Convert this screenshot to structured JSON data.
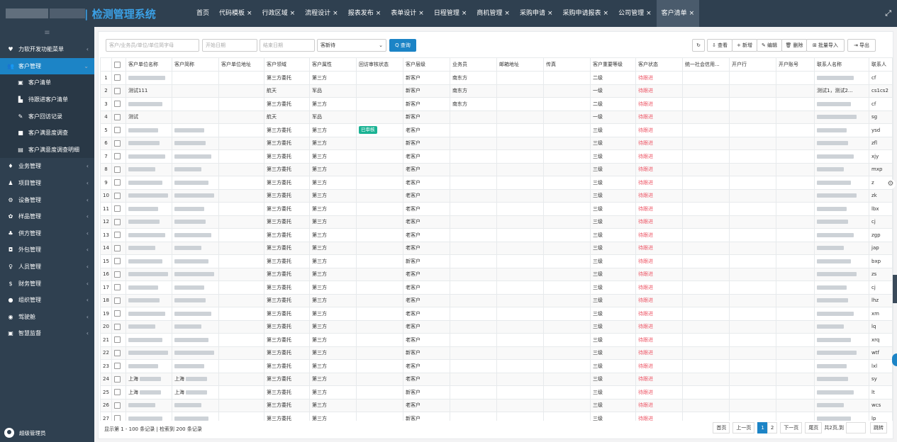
{
  "app": {
    "title": "| 检测管理系统"
  },
  "tabs": [
    {
      "label": "首页",
      "closable": false
    },
    {
      "label": "代码模板",
      "closable": true
    },
    {
      "label": "行政区域",
      "closable": true
    },
    {
      "label": "流程设计",
      "closable": true
    },
    {
      "label": "报表发布",
      "closable": true
    },
    {
      "label": "表单设计",
      "closable": true
    },
    {
      "label": "日程管理",
      "closable": true
    },
    {
      "label": "商机管理",
      "closable": true
    },
    {
      "label": "采购申请",
      "closable": true
    },
    {
      "label": "采购申请报表",
      "closable": true
    },
    {
      "label": "公司管理",
      "closable": true
    },
    {
      "label": "客户清单",
      "closable": true,
      "active": true
    }
  ],
  "sidebar": {
    "toggle_icon": "≡",
    "items": [
      {
        "icon": "♥",
        "label": "力软开发功能菜单",
        "arrow": "‹"
      },
      {
        "icon": "👥",
        "label": "客户管理",
        "arrow": "⌄",
        "active": true
      },
      {
        "icon": "▣",
        "label": "客户清单",
        "sub": true
      },
      {
        "icon": "▙",
        "label": "待跟进客户清单",
        "sub": true
      },
      {
        "icon": "✎",
        "label": "客户回访记录",
        "sub": true
      },
      {
        "icon": "■",
        "label": "客户满意度调查",
        "sub": true
      },
      {
        "icon": "▤",
        "label": "客户满意度调查明细",
        "sub": true
      },
      {
        "icon": "♦",
        "label": "业务管理",
        "arrow": "‹"
      },
      {
        "icon": "♟",
        "label": "项目管理",
        "arrow": "‹"
      },
      {
        "icon": "⚙",
        "label": "设备管理",
        "arrow": "‹"
      },
      {
        "icon": "✿",
        "label": "样品管理",
        "arrow": "‹"
      },
      {
        "icon": "♣",
        "label": "供方管理",
        "arrow": "‹"
      },
      {
        "icon": "◘",
        "label": "外包管理",
        "arrow": "‹"
      },
      {
        "icon": "♀",
        "label": "人员管理",
        "arrow": "‹"
      },
      {
        "icon": "$",
        "label": "财务管理",
        "arrow": "‹"
      },
      {
        "icon": "●",
        "label": "组织管理",
        "arrow": "‹"
      },
      {
        "icon": "◉",
        "label": "驾驶舱",
        "arrow": "‹"
      },
      {
        "icon": "▣",
        "label": "智慧监督",
        "arrow": "‹"
      }
    ],
    "user": "超级管理员"
  },
  "toolbar": {
    "search_placeholder": "客户/业务员/单位/单位简字母",
    "start_placeholder": "开始日期",
    "end_placeholder": "结束日期",
    "status_select": "客新待",
    "query_label": "Q 查询",
    "buttons": {
      "refresh": "↻",
      "view": "⇩ 查看",
      "add": "+ 新增",
      "edit": "✎ 编辑",
      "delete": "🗑 删除",
      "import": "⊞ 批量导入",
      "export": "⇥ 导出"
    }
  },
  "table": {
    "headers": [
      "",
      "",
      "客户单位名称",
      "客户简称",
      "客户单位地址",
      "客户领域",
      "客户属性",
      "回访审核状态",
      "客户层级",
      "业务员",
      "邮箱地址",
      "传真",
      "客户重要等级",
      "客户状态",
      "统一社会信用...",
      "开户行",
      "开户账号",
      "联系人名称",
      "联系人"
    ],
    "rows": [
      {
        "n": "1",
        "name": "blur",
        "short": "",
        "field": "第三方委托",
        "attr": "第三方",
        "audit": "",
        "level": "新客户",
        "sales": "南东方",
        "grade": "二级",
        "status": "待跟进",
        "contact": "blur",
        "code": "cf"
      },
      {
        "n": "2",
        "name": "测试111",
        "short": "",
        "field": "航天",
        "attr": "军品",
        "audit": "",
        "level": "新客户",
        "sales": "南东方",
        "grade": "一级",
        "status": "待跟进",
        "contact": "测试1，测试2...",
        "code": "cs1cs2"
      },
      {
        "n": "3",
        "name": "blur",
        "short": "",
        "field": "第三方委托",
        "attr": "第三方",
        "audit": "",
        "level": "新客户",
        "sales": "南东方",
        "grade": "二级",
        "status": "待跟进",
        "contact": "blur",
        "code": "cf"
      },
      {
        "n": "4",
        "name": "测试",
        "short": "",
        "field": "航天",
        "attr": "军品",
        "audit": "",
        "level": "新客户",
        "sales": "",
        "grade": "一级",
        "status": "待跟进",
        "contact": "blur",
        "code": "sg"
      },
      {
        "n": "5",
        "name": "blur",
        "short": "blur",
        "field": "第三方委托",
        "attr": "第三方",
        "audit": "已审核",
        "level": "老客户",
        "sales": "",
        "grade": "三级",
        "status": "待跟进",
        "contact": "blur",
        "code": "ysd"
      },
      {
        "n": "6",
        "name": "blur",
        "short": "blur",
        "field": "第三方委托",
        "attr": "第三方",
        "audit": "",
        "level": "新客户",
        "sales": "",
        "grade": "三级",
        "status": "待跟进",
        "contact": "blur",
        "code": "zfl"
      },
      {
        "n": "7",
        "name": "blur",
        "short": "blur",
        "field": "第三方委托",
        "attr": "第三方",
        "audit": "",
        "level": "老客户",
        "sales": "",
        "grade": "三级",
        "status": "待跟进",
        "contact": "blur",
        "code": "xjy"
      },
      {
        "n": "8",
        "name": "blur",
        "short": "blur",
        "field": "第三方委托",
        "attr": "第三方",
        "audit": "",
        "level": "老客户",
        "sales": "",
        "grade": "三级",
        "status": "待跟进",
        "contact": "blur",
        "code": "mxp"
      },
      {
        "n": "9",
        "name": "blur",
        "short": "blur",
        "field": "第三方委托",
        "attr": "第三方",
        "audit": "",
        "level": "老客户",
        "sales": "",
        "grade": "三级",
        "status": "待跟进",
        "contact": "blur",
        "code": "z"
      },
      {
        "n": "10",
        "name": "blur",
        "short": "blur",
        "field": "第三方委托",
        "attr": "第三方",
        "audit": "",
        "level": "老客户",
        "sales": "",
        "grade": "三级",
        "status": "待跟进",
        "contact": "blur",
        "code": "zk"
      },
      {
        "n": "11",
        "name": "blur",
        "short": "blur",
        "field": "第三方委托",
        "attr": "第三方",
        "audit": "",
        "level": "老客户",
        "sales": "",
        "grade": "三级",
        "status": "待跟进",
        "contact": "blur",
        "code": "lbx"
      },
      {
        "n": "12",
        "name": "blur",
        "short": "blur",
        "field": "第三方委托",
        "attr": "第三方",
        "audit": "",
        "level": "老客户",
        "sales": "",
        "grade": "三级",
        "status": "待跟进",
        "contact": "blur",
        "code": "cj"
      },
      {
        "n": "13",
        "name": "blur",
        "short": "blur",
        "field": "第三方委托",
        "attr": "第三方",
        "audit": "",
        "level": "老客户",
        "sales": "",
        "grade": "三级",
        "status": "待跟进",
        "contact": "blur",
        "code": "zgp"
      },
      {
        "n": "14",
        "name": "blur",
        "short": "blur",
        "field": "第三方委托",
        "attr": "第三方",
        "audit": "",
        "level": "老客户",
        "sales": "",
        "grade": "三级",
        "status": "待跟进",
        "contact": "blur",
        "code": "jap"
      },
      {
        "n": "15",
        "name": "blur",
        "short": "blur",
        "field": "第三方委托",
        "attr": "第三方",
        "audit": "",
        "level": "新客户",
        "sales": "",
        "grade": "三级",
        "status": "待跟进",
        "contact": "blur",
        "code": "bxp"
      },
      {
        "n": "16",
        "name": "blur",
        "short": "blur",
        "field": "第三方委托",
        "attr": "第三方",
        "audit": "",
        "level": "老客户",
        "sales": "",
        "grade": "三级",
        "status": "待跟进",
        "contact": "blur",
        "code": "zs"
      },
      {
        "n": "17",
        "name": "blur",
        "short": "blur",
        "field": "第三方委托",
        "attr": "第三方",
        "audit": "",
        "level": "老客户",
        "sales": "",
        "grade": "三级",
        "status": "待跟进",
        "contact": "blur",
        "code": "cj"
      },
      {
        "n": "18",
        "name": "blur",
        "short": "blur",
        "field": "第三方委托",
        "attr": "第三方",
        "audit": "",
        "level": "老客户",
        "sales": "",
        "grade": "三级",
        "status": "待跟进",
        "contact": "blur",
        "code": "lhz"
      },
      {
        "n": "19",
        "name": "blur",
        "short": "blur",
        "field": "第三方委托",
        "attr": "第三方",
        "audit": "",
        "level": "老客户",
        "sales": "",
        "grade": "三级",
        "status": "待跟进",
        "contact": "blur",
        "code": "xm"
      },
      {
        "n": "20",
        "name": "blur",
        "short": "blur",
        "field": "第三方委托",
        "attr": "第三方",
        "audit": "",
        "level": "老客户",
        "sales": "",
        "grade": "三级",
        "status": "待跟进",
        "contact": "blur",
        "code": "lq"
      },
      {
        "n": "21",
        "name": "blur",
        "short": "blur",
        "field": "第三方委托",
        "attr": "第三方",
        "audit": "",
        "level": "老客户",
        "sales": "",
        "grade": "三级",
        "status": "待跟进",
        "contact": "blur",
        "code": "xrq"
      },
      {
        "n": "22",
        "name": "blur",
        "short": "blur",
        "field": "第三方委托",
        "attr": "第三方",
        "audit": "",
        "level": "新客户",
        "sales": "",
        "grade": "三级",
        "status": "待跟进",
        "contact": "blur",
        "code": "wtf"
      },
      {
        "n": "23",
        "name": "blur",
        "short": "blur",
        "field": "第三方委托",
        "attr": "第三方",
        "audit": "",
        "level": "老客户",
        "sales": "",
        "grade": "三级",
        "status": "待跟进",
        "contact": "blur",
        "code": "lxl"
      },
      {
        "n": "24",
        "name": "上海blur",
        "short": "上海blur",
        "field": "第三方委托",
        "attr": "第三方",
        "audit": "",
        "level": "老客户",
        "sales": "",
        "grade": "三级",
        "status": "待跟进",
        "contact": "blur",
        "code": "sy"
      },
      {
        "n": "25",
        "name": "上海blur",
        "short": "上海blur",
        "field": "第三方委托",
        "attr": "第三方",
        "audit": "",
        "level": "新客户",
        "sales": "",
        "grade": "三级",
        "status": "待跟进",
        "contact": "blur",
        "code": "lt"
      },
      {
        "n": "26",
        "name": "blur",
        "short": "blur",
        "field": "第三方委托",
        "attr": "第三方",
        "audit": "",
        "level": "老客户",
        "sales": "",
        "grade": "三级",
        "status": "待跟进",
        "contact": "blur",
        "code": "wcs"
      },
      {
        "n": "27",
        "name": "blur",
        "short": "blur",
        "field": "第三方委托",
        "attr": "第三方",
        "audit": "",
        "level": "新客户",
        "sales": "",
        "grade": "三级",
        "status": "待跟进",
        "contact": "blur",
        "code": "lp"
      }
    ]
  },
  "footer": {
    "summary": "显示第 1 - 100 条记录 | 检索到 200 条记录"
  },
  "pager": {
    "first": "首页",
    "prev": "上一页",
    "p1": "1",
    "p2": "2",
    "next": "下一页",
    "last": "尾页",
    "total": "共2页,到",
    "go": "跳转"
  },
  "colors": {
    "topbar": "#2f4050",
    "accent": "#1c84c6",
    "status_red": "#ed5565",
    "badge_green": "#1ab394"
  },
  "icons": {
    "fullscreen": "fullscreen-icon",
    "settings": "gear-icon"
  }
}
